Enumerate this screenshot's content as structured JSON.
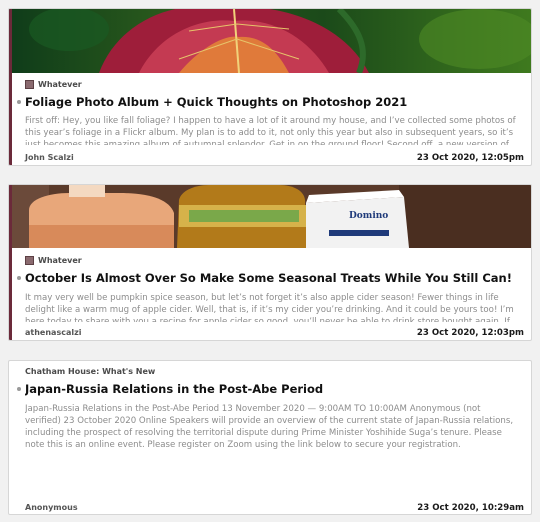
{
  "articles": [
    {
      "source": "Whatever",
      "has_favicon": true,
      "title": "Foliage Photo Album + Quick Thoughts on Photoshop 2021",
      "summary": "First off: Hey, you like fall foliage? I happen to have a lot of it around my house, and I’ve collected some photos of this year’s foliage in a Flickr album. My plan is to add to it, not only this year but also in subsequent years, so it’s just becomes this amazing album of autumnal splendor. Get in on the ground floor! Second off, a new version of Photoshop",
      "author": "John Scalzi",
      "date": "23 Oct 2020, 12:05pm",
      "image": "autumn-leaf-photo"
    },
    {
      "source": "Whatever",
      "has_favicon": true,
      "title": "October Is Almost Over So Make Some Seasonal Treats While You Still Can!",
      "summary": "It may very well be pumpkin spice season, but let’s not forget it’s also apple cider season! Fewer things in life delight like a warm mug of apple cider. Well, that is, if it’s my cider you’re drinking. And it could be yours too! I’m here today to share with you a recipe for apple cider so good, you’ll never be able to drink store bought again. If you’re not ready for",
      "author": "athenascalzi",
      "date": "23 Oct 2020, 12:03pm",
      "image": "cider-jugs-photo",
      "image_text": "Domino"
    },
    {
      "source": "Chatham House: What's New",
      "has_favicon": false,
      "title": "Japan-Russia Relations in the Post-Abe Period",
      "summary": "Japan-Russia Relations in the Post-Abe Period 13 November 2020 — 9:00AM TO 10:00AM Anonymous (not verified) 23 October 2020 Online Speakers will provide an overview of the current state of Japan-Russia relations, including the prospect of resolving the territorial dispute during Prime Minister Yoshihide Suga’s tenure. Please note this is an online event. Please register on Zoom using the link below to secure your registration.",
      "author": "Anonymous",
      "date": "23 Oct 2020, 10:29am"
    }
  ],
  "colors": {
    "unread_bar": "#6b2a3a",
    "background": "#f1f1f1"
  }
}
